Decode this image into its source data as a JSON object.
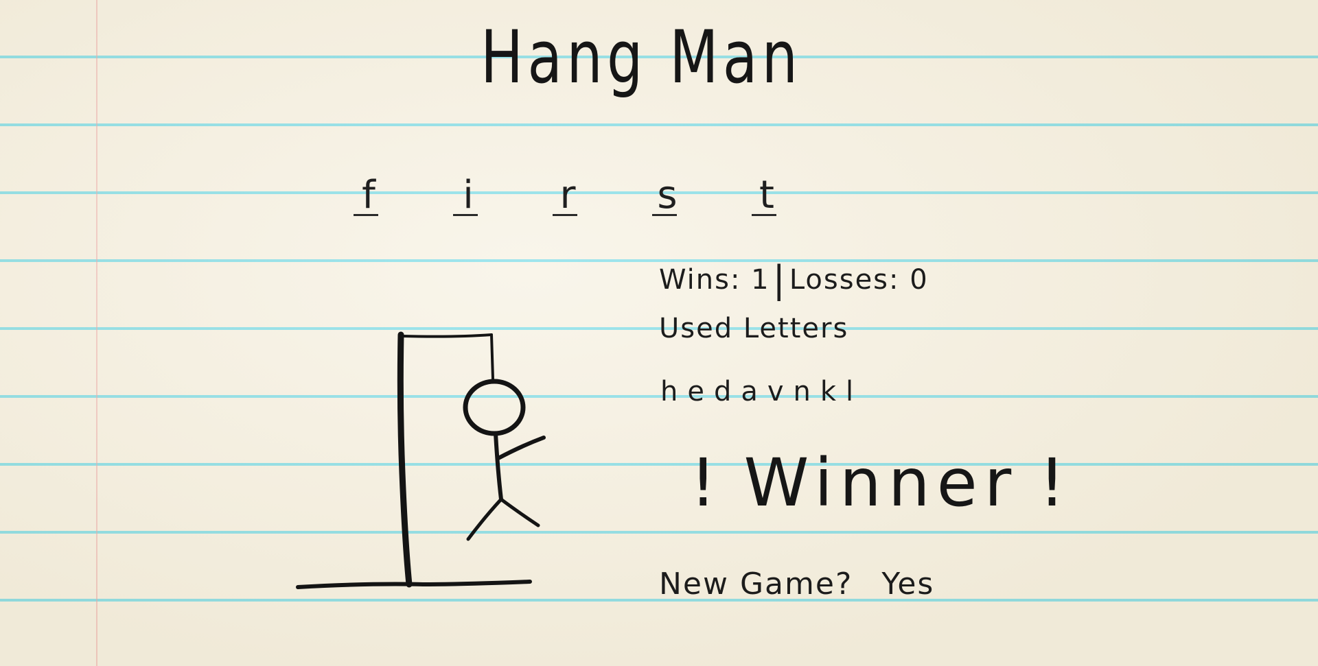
{
  "title": "Hang Man",
  "word": {
    "letters": [
      "f",
      "i",
      "r",
      "s",
      "t"
    ]
  },
  "stats": {
    "wins_label": "Wins:",
    "wins": "1",
    "separator": "|",
    "losses_label": "Losses:",
    "losses": "0"
  },
  "used": {
    "label": "Used Letters",
    "letters": "hedavnkl"
  },
  "result": {
    "bang_left": "!",
    "text": "Winner",
    "bang_right": "!"
  },
  "new_game": {
    "label": "New Game?",
    "yes_label": "Yes"
  },
  "colors": {
    "paper": "#f7f2e4",
    "rule_line": "#58d6e9",
    "margin_line": "#eca0a0",
    "ink": "#161616"
  },
  "hangman": {
    "parts_shown": [
      "head",
      "body",
      "right-arm",
      "left-leg",
      "right-leg"
    ]
  }
}
